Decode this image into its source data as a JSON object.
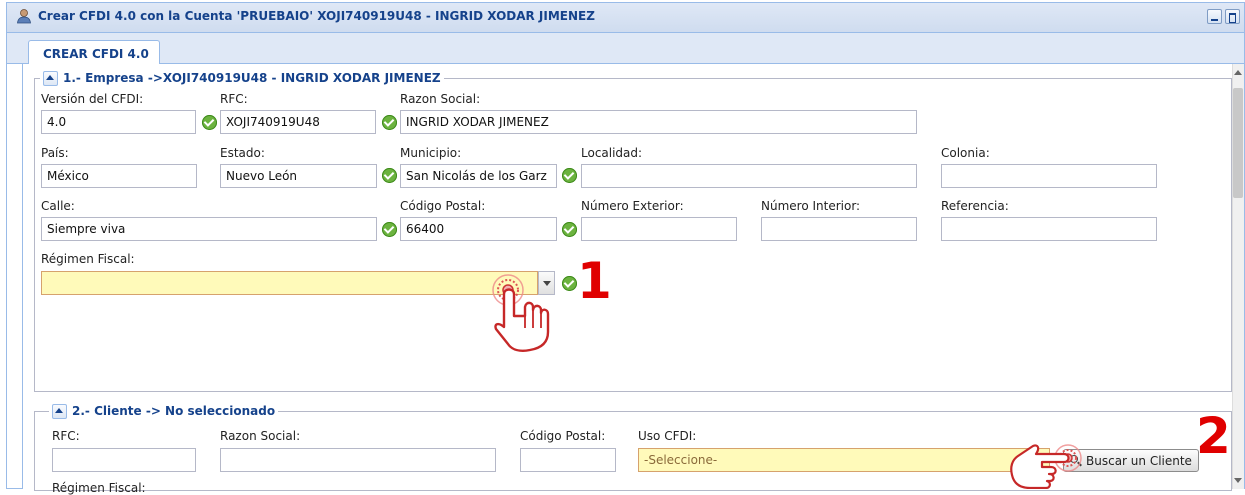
{
  "window": {
    "title": "Crear CFDI 4.0 con la Cuenta 'PRUEBAIO' XOJI740919U48 - INGRID XODAR JIMENEZ",
    "icon": "user-icon",
    "tab": "CREAR CFDI 4.0"
  },
  "empresa": {
    "legend": "1.- Empresa ->XOJI740919U48 - INGRID XODAR JIMENEZ",
    "version_label": "Versión del CFDI:",
    "version_value": "4.0",
    "rfc_label": "RFC:",
    "rfc_value": "XOJI740919U48",
    "razon_label": "Razon Social:",
    "razon_value": "INGRID XODAR JIMENEZ",
    "pais_label": "País:",
    "pais_value": "México",
    "estado_label": "Estado:",
    "estado_value": "Nuevo León",
    "municipio_label": "Municipio:",
    "municipio_value": "San Nicolás de los Garz",
    "localidad_label": "Localidad:",
    "localidad_value": "",
    "colonia_label": "Colonia:",
    "colonia_value": "",
    "calle_label": "Calle:",
    "calle_value": "Siempre viva",
    "cp_label": "Código Postal:",
    "cp_value": "66400",
    "num_ext_label": "Número Exterior:",
    "num_ext_value": "",
    "num_int_label": "Número Interior:",
    "num_int_value": "",
    "referencia_label": "Referencia:",
    "referencia_value": "",
    "regimen_label": "Régimen Fiscal:",
    "regimen_value": ""
  },
  "cliente": {
    "legend": "2.- Cliente -> No seleccionado",
    "rfc_label": "RFC:",
    "razon_label": "Razon Social:",
    "cp_label": "Código Postal:",
    "uso_label": "Uso CFDI:",
    "uso_value": "-Seleccione-",
    "buscar_label": "Buscar un Cliente",
    "regimen_label": "Régimen Fiscal:"
  },
  "annotations": {
    "step1": "1",
    "step2": "2",
    "color": "#e00000"
  },
  "colors": {
    "accent": "#15428b",
    "required_field": "#fffaba",
    "valid_check": "#6cb33f"
  }
}
